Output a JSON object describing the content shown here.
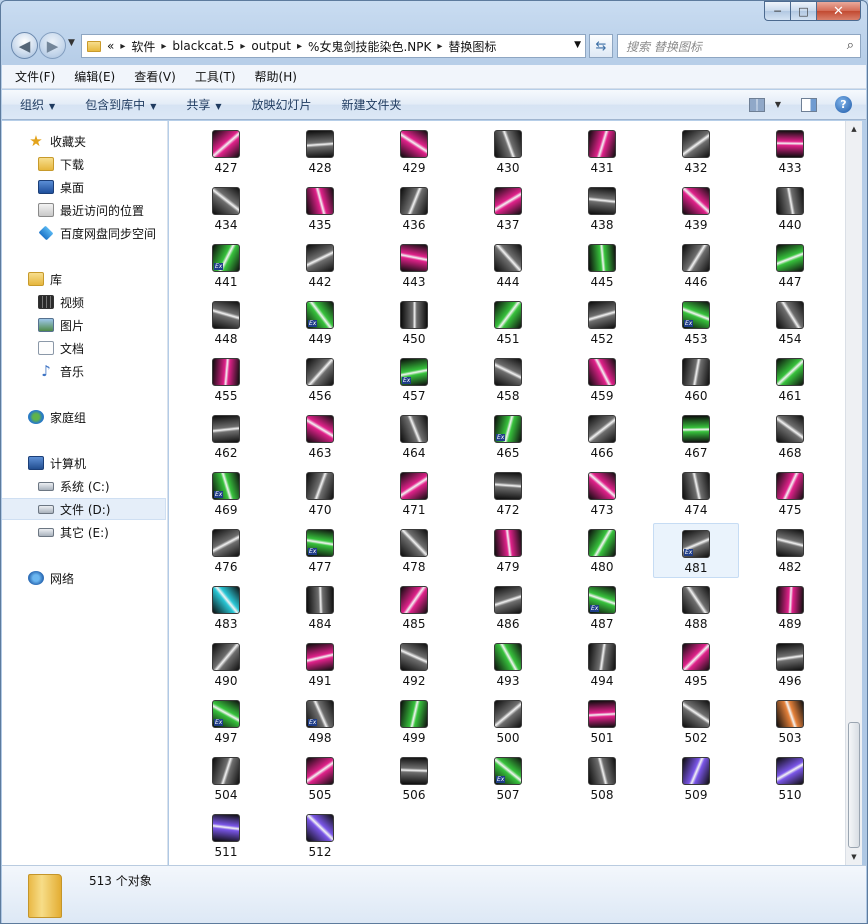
{
  "window": {
    "caption_min": "─",
    "caption_max": "□",
    "caption_close": "✕"
  },
  "address": {
    "overflow": "«",
    "crumbs": [
      "软件",
      "blackcat.5",
      "output",
      "%女鬼剑技能染色.NPK",
      "替换图标"
    ],
    "search_placeholder": "搜索 替换图标"
  },
  "menu": [
    "文件(F)",
    "编辑(E)",
    "查看(V)",
    "工具(T)",
    "帮助(H)"
  ],
  "commands": [
    {
      "label": "组织",
      "dropdown": true
    },
    {
      "label": "包含到库中",
      "dropdown": true
    },
    {
      "label": "共享",
      "dropdown": true
    },
    {
      "label": "放映幻灯片",
      "dropdown": false
    },
    {
      "label": "新建文件夹",
      "dropdown": false
    }
  ],
  "nav": {
    "favorites": {
      "label": "收藏夹",
      "icon": "star-icon"
    },
    "fav_items": [
      {
        "label": "下载",
        "icon": "downloads-folder-icon"
      },
      {
        "label": "桌面",
        "icon": "desktop-icon"
      },
      {
        "label": "最近访问的位置",
        "icon": "recent-places-icon"
      },
      {
        "label": "百度网盘同步空间",
        "icon": "baidu-netdisk-icon"
      }
    ],
    "libraries": {
      "label": "库",
      "icon": "library-icon"
    },
    "lib_items": [
      {
        "label": "视频",
        "icon": "video-icon"
      },
      {
        "label": "图片",
        "icon": "pictures-icon"
      },
      {
        "label": "文档",
        "icon": "documents-icon"
      },
      {
        "label": "音乐",
        "icon": "music-icon"
      }
    ],
    "homegroup": {
      "label": "家庭组",
      "icon": "homegroup-icon"
    },
    "computer": {
      "label": "计算机",
      "icon": "computer-icon"
    },
    "drives": [
      {
        "label": "系统 (C:)",
        "icon": "system-drive-icon",
        "selected": false
      },
      {
        "label": "文件 (D:)",
        "icon": "drive-icon",
        "selected": true
      },
      {
        "label": "其它 (E:)",
        "icon": "drive-icon",
        "selected": false
      }
    ],
    "network": {
      "label": "网络",
      "icon": "network-icon"
    }
  },
  "files": {
    "first": 427,
    "last": 512,
    "selected": "481",
    "accent_colors": {
      "pink": "#e0218a",
      "gray": "#6e6e6e",
      "green": "#37c23c",
      "cyan": "#29c7d6",
      "orange": "#e5813a",
      "violet": "#7a56e8"
    },
    "themes": [
      "pink",
      "gray",
      "pink",
      "gray",
      "pink",
      "gray",
      "pink",
      "gray",
      "pink",
      "gray",
      "pink",
      "gray",
      "pink",
      "gray",
      "green",
      "gray",
      "pink",
      "gray",
      "green",
      "gray",
      "green",
      "gray",
      "green",
      "gray",
      "green",
      "gray",
      "green",
      "gray",
      "pink",
      "gray",
      "green",
      "gray",
      "pink",
      "gray",
      "green",
      "gray",
      "pink",
      "gray",
      "green",
      "gray",
      "green",
      "gray",
      "green",
      "gray",
      "pink",
      "gray",
      "pink",
      "gray",
      "pink",
      "gray",
      "green",
      "gray",
      "pink",
      "green",
      "gray",
      "gray",
      "cyan",
      "gray",
      "pink",
      "gray",
      "green",
      "gray",
      "pink",
      "gray",
      "pink",
      "gray",
      "green",
      "gray",
      "pink",
      "gray",
      "green",
      "gray",
      "green",
      "gray",
      "pink",
      "gray",
      "orange",
      "gray",
      "pink",
      "gray",
      "green",
      "gray",
      "violet",
      "violet",
      "violet",
      "violet"
    ],
    "ex_badges": [
      441,
      449,
      453,
      457,
      465,
      469,
      477,
      481,
      487,
      497,
      498,
      507
    ]
  },
  "status": {
    "count_text": "513 个对象"
  }
}
